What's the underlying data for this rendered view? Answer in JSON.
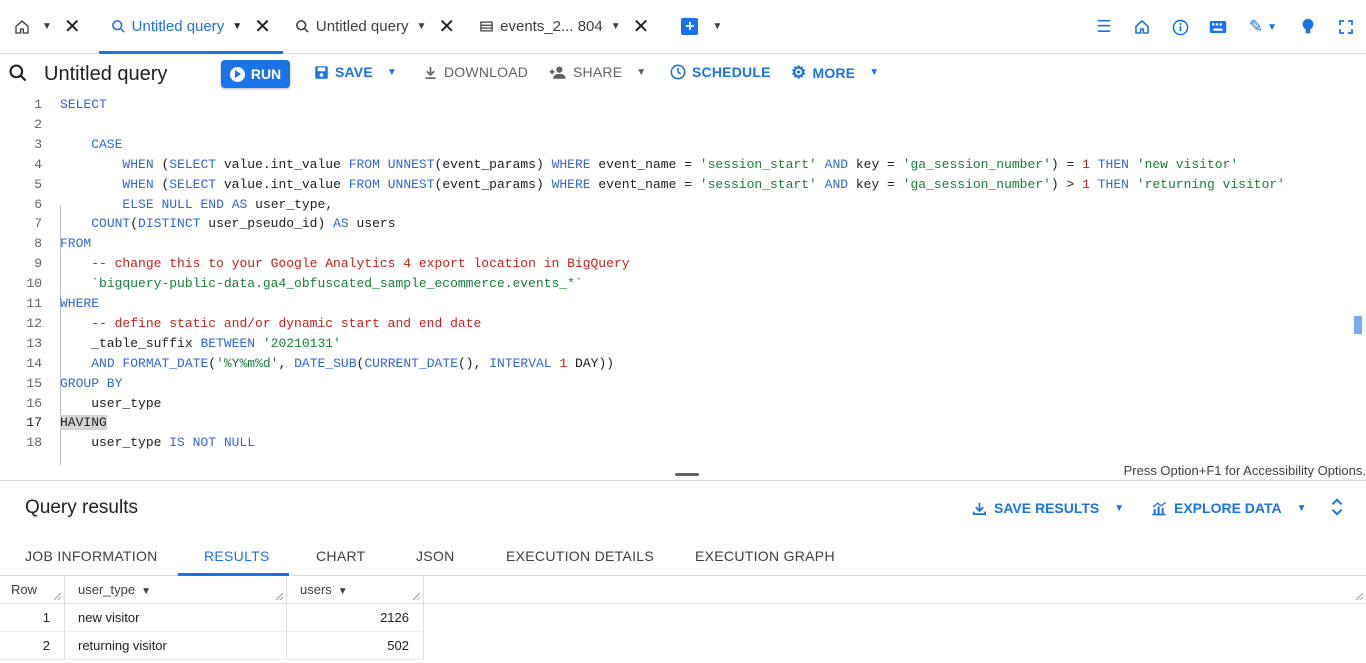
{
  "tabs": [
    {
      "label": "Untitled query",
      "active": true
    },
    {
      "label": "Untitled query",
      "active": false
    },
    {
      "label": "events_2... 804",
      "active": false
    }
  ],
  "toolbar": {
    "title": "Untitled query",
    "run": "RUN",
    "save": "SAVE",
    "download": "DOWNLOAD",
    "share": "SHARE",
    "schedule": "SCHEDULE",
    "more": "MORE"
  },
  "editor": {
    "current_line": 17,
    "a11y_hint": "Press Option+F1 for Accessibility Options.",
    "lines": [
      {
        "n": "1",
        "t": [
          [
            "kw",
            "SELECT"
          ]
        ]
      },
      {
        "n": "2",
        "t": []
      },
      {
        "n": "3",
        "t": [
          [
            "txt",
            "    "
          ],
          [
            "kw",
            "CASE"
          ]
        ]
      },
      {
        "n": "4",
        "t": [
          [
            "txt",
            "        "
          ],
          [
            "kw",
            "WHEN"
          ],
          [
            "txt",
            " ("
          ],
          [
            "kw",
            "SELECT"
          ],
          [
            "txt",
            " value.int_value "
          ],
          [
            "kw",
            "FROM"
          ],
          [
            "txt",
            " "
          ],
          [
            "kw",
            "UNNEST"
          ],
          [
            "txt",
            "(event_params) "
          ],
          [
            "kw",
            "WHERE"
          ],
          [
            "txt",
            " event_name = "
          ],
          [
            "str",
            "'session_start'"
          ],
          [
            "txt",
            " "
          ],
          [
            "kw",
            "AND"
          ],
          [
            "txt",
            " key = "
          ],
          [
            "str",
            "'ga_session_number'"
          ],
          [
            "txt",
            ") = "
          ],
          [
            "num",
            "1"
          ],
          [
            "txt",
            " "
          ],
          [
            "kw",
            "THEN"
          ],
          [
            "txt",
            " "
          ],
          [
            "str",
            "'new visitor'"
          ]
        ]
      },
      {
        "n": "5",
        "t": [
          [
            "txt",
            "        "
          ],
          [
            "kw",
            "WHEN"
          ],
          [
            "txt",
            " ("
          ],
          [
            "kw",
            "SELECT"
          ],
          [
            "txt",
            " value.int_value "
          ],
          [
            "kw",
            "FROM"
          ],
          [
            "txt",
            " "
          ],
          [
            "kw",
            "UNNEST"
          ],
          [
            "txt",
            "(event_params) "
          ],
          [
            "kw",
            "WHERE"
          ],
          [
            "txt",
            " event_name = "
          ],
          [
            "str",
            "'session_start'"
          ],
          [
            "txt",
            " "
          ],
          [
            "kw",
            "AND"
          ],
          [
            "txt",
            " key = "
          ],
          [
            "str",
            "'ga_session_number'"
          ],
          [
            "txt",
            ") > "
          ],
          [
            "num",
            "1"
          ],
          [
            "txt",
            " "
          ],
          [
            "kw",
            "THEN"
          ],
          [
            "txt",
            " "
          ],
          [
            "str",
            "'returning visitor'"
          ]
        ]
      },
      {
        "n": "6",
        "t": [
          [
            "txt",
            "        "
          ],
          [
            "kw",
            "ELSE"
          ],
          [
            "txt",
            " "
          ],
          [
            "kw",
            "NULL"
          ],
          [
            "txt",
            " "
          ],
          [
            "kw",
            "END"
          ],
          [
            "txt",
            " "
          ],
          [
            "kw",
            "AS"
          ],
          [
            "txt",
            " user_type,"
          ]
        ]
      },
      {
        "n": "7",
        "t": [
          [
            "txt",
            "    "
          ],
          [
            "kw",
            "COUNT"
          ],
          [
            "txt",
            "("
          ],
          [
            "kw",
            "DISTINCT"
          ],
          [
            "txt",
            " user_pseudo_id) "
          ],
          [
            "kw",
            "AS"
          ],
          [
            "txt",
            " users"
          ]
        ]
      },
      {
        "n": "8",
        "t": [
          [
            "kw",
            "FROM"
          ]
        ]
      },
      {
        "n": "9",
        "t": [
          [
            "txt",
            "    "
          ],
          [
            "com",
            "-- change this to your Google Analytics 4 export location in BigQuery"
          ]
        ]
      },
      {
        "n": "10",
        "t": [
          [
            "txt",
            "    "
          ],
          [
            "str",
            "`bigquery-public-data.ga4_obfuscated_sample_ecommerce.events_*`"
          ]
        ]
      },
      {
        "n": "11",
        "t": [
          [
            "kw",
            "WHERE"
          ]
        ]
      },
      {
        "n": "12",
        "t": [
          [
            "txt",
            "    "
          ],
          [
            "com",
            "-- define static and/or dynamic start and end date"
          ]
        ]
      },
      {
        "n": "13",
        "t": [
          [
            "txt",
            "    _table_suffix "
          ],
          [
            "kw",
            "BETWEEN"
          ],
          [
            "txt",
            " "
          ],
          [
            "str",
            "'20210131'"
          ]
        ]
      },
      {
        "n": "14",
        "t": [
          [
            "txt",
            "    "
          ],
          [
            "kw",
            "AND"
          ],
          [
            "txt",
            " "
          ],
          [
            "kw",
            "FORMAT_DATE"
          ],
          [
            "txt",
            "("
          ],
          [
            "str",
            "'%Y%m%d'"
          ],
          [
            "txt",
            ", "
          ],
          [
            "kw",
            "DATE_SUB"
          ],
          [
            "txt",
            "("
          ],
          [
            "kw",
            "CURRENT_DATE"
          ],
          [
            "txt",
            "(), "
          ],
          [
            "kw",
            "INTERVAL"
          ],
          [
            "txt",
            " "
          ],
          [
            "num",
            "1"
          ],
          [
            "txt",
            " DAY))"
          ]
        ]
      },
      {
        "n": "15",
        "t": [
          [
            "kw",
            "GROUP BY"
          ]
        ]
      },
      {
        "n": "16",
        "t": [
          [
            "txt",
            "    user_type"
          ]
        ]
      },
      {
        "n": "17",
        "t": [
          [
            "hl",
            "HAVING"
          ]
        ]
      },
      {
        "n": "18",
        "t": [
          [
            "txt",
            "    user_type "
          ],
          [
            "kw",
            "IS NOT NULL"
          ]
        ]
      }
    ]
  },
  "results": {
    "title": "Query results",
    "save_results": "SAVE RESULTS",
    "explore_data": "EXPLORE DATA",
    "tabs": [
      "JOB INFORMATION",
      "RESULTS",
      "CHART",
      "JSON",
      "EXECUTION DETAILS",
      "EXECUTION GRAPH"
    ],
    "active_tab": "RESULTS",
    "columns": [
      "Row",
      "user_type",
      "users"
    ],
    "rows": [
      {
        "row": "1",
        "user_type": "new visitor",
        "users": "2126"
      },
      {
        "row": "2",
        "user_type": "returning visitor",
        "users": "502"
      }
    ]
  },
  "colors": {
    "accent": "#1a73e8",
    "keyword": "#3367d6",
    "string": "#188038",
    "comment": "#c5221f"
  }
}
